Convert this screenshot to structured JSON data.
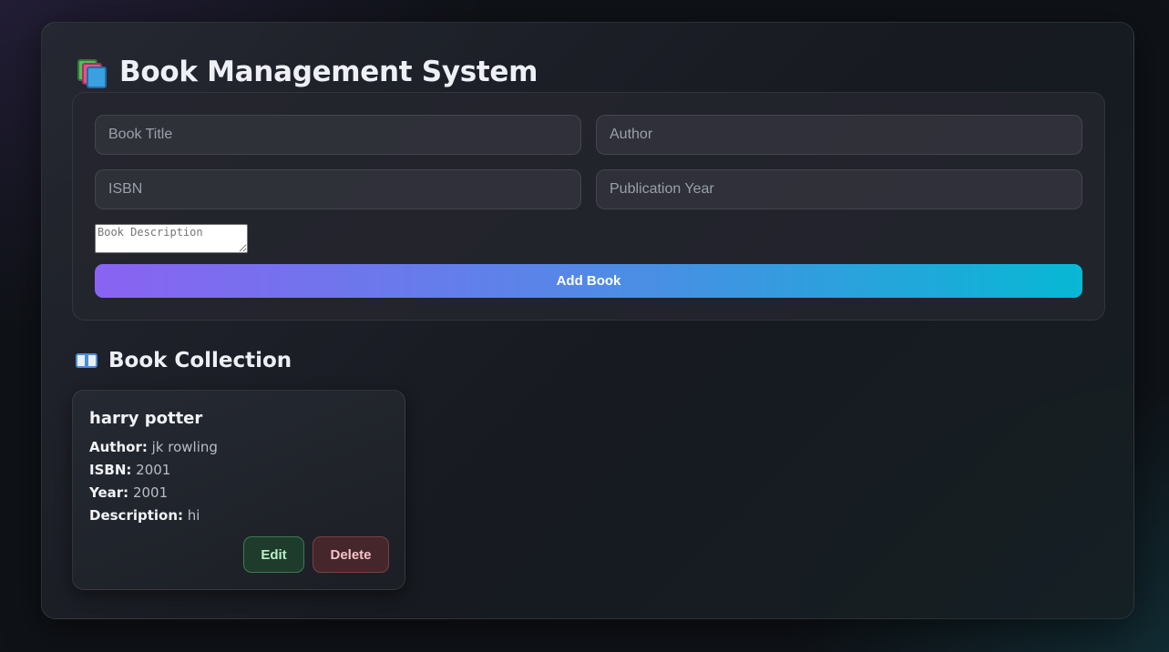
{
  "header": {
    "title": "Book Management System",
    "icon": "books-icon"
  },
  "form": {
    "title_placeholder": "Book Title",
    "author_placeholder": "Author",
    "isbn_placeholder": "ISBN",
    "year_placeholder": "Publication Year",
    "description_placeholder": "Book Description",
    "title_value": "",
    "author_value": "",
    "isbn_value": "",
    "year_value": "",
    "description_value": "",
    "add_label": "Add Book",
    "add_gradient": [
      "#8a63f2",
      "#5a84e8",
      "#07b8d4"
    ]
  },
  "collection": {
    "title": "Book Collection",
    "icon": "open-book-icon",
    "books": [
      {
        "title": "harry potter",
        "author_label": "Author:",
        "author": "jk rowling",
        "isbn_label": "ISBN:",
        "isbn": "2001",
        "year_label": "Year:",
        "year": "2001",
        "description_label": "Description:",
        "description": "hi",
        "edit_label": "Edit",
        "delete_label": "Delete"
      }
    ]
  },
  "colors": {
    "background": "#0f1217",
    "edit": "#1f3b2c",
    "delete": "#45262b"
  }
}
